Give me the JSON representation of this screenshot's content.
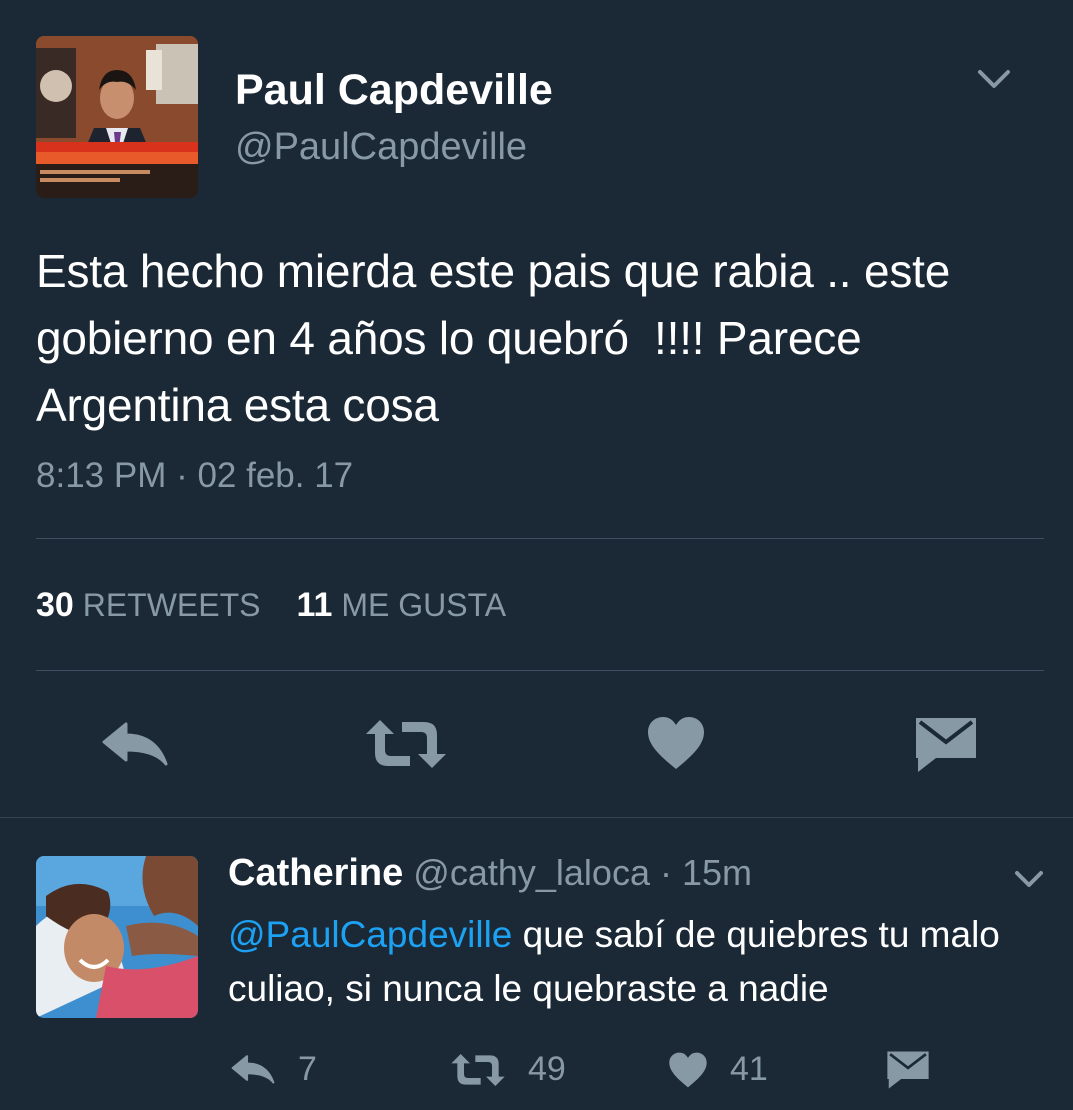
{
  "tweet": {
    "display_name": "Paul Capdeville",
    "handle": "@PaulCapdeville",
    "text_lines": [
      "Esta hecho mierda este pais que rabia .. este",
      "gobierno en 4 años lo quebró  !!!! Parece",
      "Argentina esta cosa"
    ],
    "timestamp": "8:13 PM · 02 feb. 17",
    "retweets_count": "30",
    "retweets_label": "RETWEETS",
    "likes_count": "11",
    "likes_label": "ME GUSTA",
    "avatar_icon": "tv-anchor-photo",
    "caret_icon": "chevron-down-icon"
  },
  "reply": {
    "display_name": "Catherine",
    "handle": "@cathy_laloca",
    "separator": "·",
    "time": "15m",
    "mention": "@PaulCapdeville",
    "text_first_rest": " que sabí de quiebres tu malo",
    "text_second_line": "culiao, si nunca le quebraste a nadie",
    "reply_count": "7",
    "retweet_count": "49",
    "like_count": "41"
  },
  "colors": {
    "background": "#1b2836",
    "text_primary": "#ffffff",
    "text_secondary": "#8899a6",
    "link": "#1da1f2",
    "icon": "#8899a6",
    "divider": "#3d4f61"
  }
}
